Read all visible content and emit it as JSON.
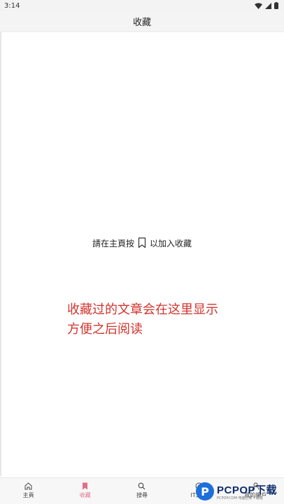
{
  "status_bar": {
    "time": "3:14"
  },
  "app_bar": {
    "title": "收藏"
  },
  "empty_state": {
    "text_before": "請在主頁按",
    "text_after": "以加入收藏"
  },
  "caption": {
    "line1": "收藏过的文章会在这里显示",
    "line2": "方便之后阅读"
  },
  "bottom_nav": {
    "items": [
      {
        "label": "主頁",
        "icon": "home-icon"
      },
      {
        "label": "收藏",
        "icon": "bookmark-icon",
        "active": true
      },
      {
        "label": "搜尋",
        "icon": "search-icon"
      },
      {
        "label": "IT之家",
        "icon": "it-icon"
      },
      {
        "label": "我的帳戶",
        "icon": "account-icon"
      }
    ]
  },
  "watermark": {
    "brand": "PCPOP下载",
    "sub": "PCPOP.COM 电脑之家下载站"
  },
  "colors": {
    "accent": "#e0708a",
    "caption": "#d2342d"
  }
}
